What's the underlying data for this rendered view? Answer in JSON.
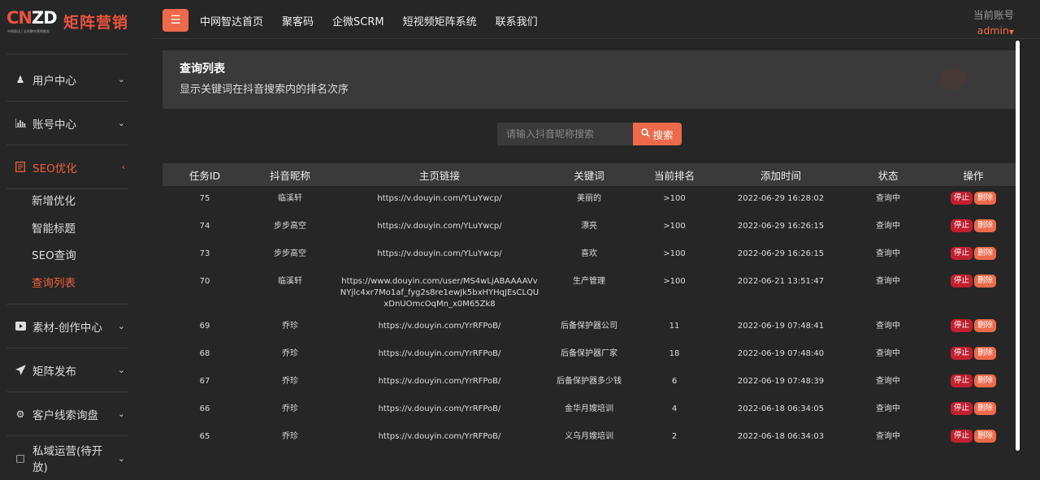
{
  "logo": {
    "mark_left": "CN",
    "mark_right": "ZD",
    "subtitle": "中网智达 | 全网整合营销服务",
    "name": "矩阵营销"
  },
  "sidebar": {
    "items": [
      {
        "label": "用户中心",
        "icon": "user-icon"
      },
      {
        "label": "账号中心",
        "icon": "bar-chart-icon"
      },
      {
        "label": "SEO优化",
        "icon": "document-icon",
        "active": true
      },
      {
        "label": "素材-创作中心",
        "icon": "video-icon"
      },
      {
        "label": "矩阵发布",
        "icon": "send-icon"
      },
      {
        "label": "客户线索询盘",
        "icon": "gear-icon"
      },
      {
        "label": "私域运营(待开放)",
        "icon": "chat-icon"
      }
    ],
    "submenu": [
      "新增优化",
      "智能标题",
      "SEO查询",
      "查询列表"
    ]
  },
  "topbar": {
    "nav": [
      "中网智达首页",
      "聚客码",
      "企微SCRM",
      "短视频矩阵系统",
      "联系我们"
    ],
    "account_label": "当前账号",
    "account_user": "admin"
  },
  "panel": {
    "title": "查询列表",
    "desc": "显示关键词在抖音搜索内的排名次序"
  },
  "search": {
    "placeholder": "请输入抖音昵称搜索",
    "button": "搜索"
  },
  "table": {
    "headers": [
      "任务ID",
      "抖音昵称",
      "主页链接",
      "关键词",
      "当前排名",
      "添加时间",
      "状态",
      "操作"
    ],
    "stop_label": "停止",
    "delete_label": "删除",
    "rows": [
      {
        "id": "75",
        "nick": "临溪轩",
        "link": "https://v.douyin.com/YLuYwcp/",
        "kw": "美丽的",
        "rank": ">100",
        "time": "2022-06-29 16:28:02",
        "status": "查询中"
      },
      {
        "id": "74",
        "nick": "步步高空",
        "link": "https://v.douyin.com/YLuYwcp/",
        "kw": "漂亮",
        "rank": ">100",
        "time": "2022-06-29 16:26:15",
        "status": "查询中"
      },
      {
        "id": "73",
        "nick": "步步高空",
        "link": "https://v.douyin.com/YLuYwcp/",
        "kw": "喜欢",
        "rank": ">100",
        "time": "2022-06-29 16:26:15",
        "status": "查询中"
      },
      {
        "id": "70",
        "nick": "临溪轩",
        "link": "https://www.douyin.com/user/MS4wLjABAAAAVvNYjlc4xr7Mo1af_fyg2s8re1ewJk5bxHYHqJEsCLQUxDnUOmcOqMn_x0M65Zk8",
        "kw": "生产管理",
        "rank": ">100",
        "time": "2022-06-21 13:51:47",
        "status": "查询中"
      },
      {
        "id": "69",
        "nick": "乔珍",
        "link": "https://v.douyin.com/YrRFPoB/",
        "kw": "后备保护器公司",
        "rank": "11",
        "time": "2022-06-19 07:48:41",
        "status": "查询中"
      },
      {
        "id": "68",
        "nick": "乔珍",
        "link": "https://v.douyin.com/YrRFPoB/",
        "kw": "后备保护器厂家",
        "rank": "18",
        "time": "2022-06-19 07:48:40",
        "status": "查询中"
      },
      {
        "id": "67",
        "nick": "乔珍",
        "link": "https://v.douyin.com/YrRFPoB/",
        "kw": "后备保护器多少钱",
        "rank": "6",
        "time": "2022-06-19 07:48:39",
        "status": "查询中"
      },
      {
        "id": "66",
        "nick": "乔珍",
        "link": "https://v.douyin.com/YrRFPoB/",
        "kw": "金华月嫂培训",
        "rank": "4",
        "time": "2022-06-18 06:34:05",
        "status": "查询中"
      },
      {
        "id": "65",
        "nick": "乔珍",
        "link": "https://v.douyin.com/YrRFPoB/",
        "kw": "义乌月嫂培训",
        "rank": "2",
        "time": "2022-06-18 06:34:03",
        "status": "查询中"
      }
    ]
  },
  "colors": {
    "accent": "#ee6a4a",
    "stop": "#c21f2f",
    "background": "#262626",
    "panel": "#3a3a3a"
  }
}
